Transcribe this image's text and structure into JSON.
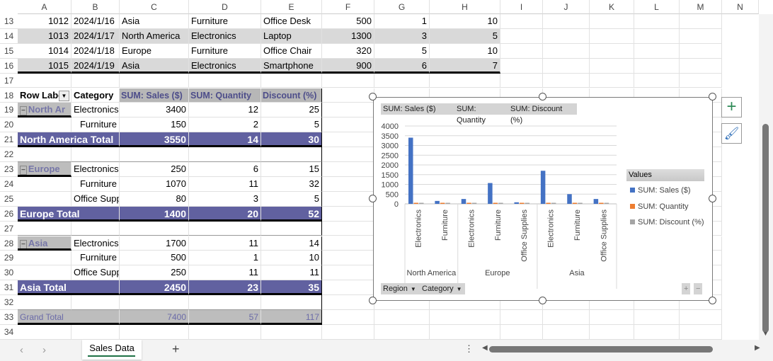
{
  "columns": [
    "A",
    "B",
    "C",
    "D",
    "E",
    "F",
    "G",
    "H",
    "I",
    "J",
    "K",
    "L",
    "M",
    "N"
  ],
  "rows": [
    {
      "n": "13",
      "type": "data",
      "cells": [
        "1012",
        "2024/1/16",
        "Asia",
        "Furniture",
        "Office Desk",
        "500",
        "1",
        "10"
      ]
    },
    {
      "n": "14",
      "type": "alt",
      "cells": [
        "1013",
        "2024/1/17",
        "North America",
        "Electronics",
        "Laptop",
        "1300",
        "3",
        "5"
      ]
    },
    {
      "n": "15",
      "type": "data",
      "cells": [
        "1014",
        "2024/1/18",
        "Europe",
        "Furniture",
        "Office Chair",
        "320",
        "5",
        "10"
      ]
    },
    {
      "n": "16",
      "type": "alt",
      "cells": [
        "1015",
        "2024/1/19",
        "Asia",
        "Electronics",
        "Smartphone",
        "900",
        "6",
        "7"
      ]
    },
    {
      "n": "17",
      "type": "blank",
      "cells": []
    },
    {
      "n": "18",
      "type": "phead",
      "cells": [
        "Row Labe",
        "Category",
        "SUM: Sales ($)",
        "SUM: Quantity",
        "Discount (%)"
      ]
    },
    {
      "n": "19",
      "type": "item",
      "cells": [
        "North Ar",
        "Electronics",
        "3400",
        "12",
        "25"
      ]
    },
    {
      "n": "20",
      "type": "item",
      "cells": [
        "",
        "Furniture",
        "150",
        "2",
        "5"
      ]
    },
    {
      "n": "21",
      "type": "total",
      "cells": [
        "North America Total",
        "",
        "3550",
        "14",
        "30"
      ]
    },
    {
      "n": "22",
      "type": "pblank",
      "cells": []
    },
    {
      "n": "23",
      "type": "item",
      "cells": [
        "Europe",
        "Electronics",
        "250",
        "6",
        "15"
      ]
    },
    {
      "n": "24",
      "type": "item",
      "cells": [
        "",
        "Furniture",
        "1070",
        "11",
        "32"
      ]
    },
    {
      "n": "25",
      "type": "item",
      "cells": [
        "",
        "Office Supplies",
        "80",
        "3",
        "5"
      ]
    },
    {
      "n": "26",
      "type": "total",
      "cells": [
        "Europe Total",
        "",
        "1400",
        "20",
        "52"
      ]
    },
    {
      "n": "27",
      "type": "pblank",
      "cells": []
    },
    {
      "n": "28",
      "type": "item",
      "cells": [
        "Asia",
        "Electronics",
        "1700",
        "11",
        "14"
      ]
    },
    {
      "n": "29",
      "type": "item",
      "cells": [
        "",
        "Furniture",
        "500",
        "1",
        "10"
      ]
    },
    {
      "n": "30",
      "type": "item",
      "cells": [
        "",
        "Office Supplies",
        "250",
        "11",
        "11"
      ]
    },
    {
      "n": "31",
      "type": "total",
      "cells": [
        "Asia Total",
        "",
        "2450",
        "23",
        "35"
      ]
    },
    {
      "n": "32",
      "type": "pblank",
      "cells": []
    },
    {
      "n": "33",
      "type": "grand",
      "cells": [
        "Grand Total",
        "",
        "7400",
        "57",
        "117"
      ]
    },
    {
      "n": "34",
      "type": "blank",
      "cells": []
    }
  ],
  "chart_data": {
    "type": "bar",
    "field_buttons": [
      "SUM: Sales ($)",
      "SUM: Quantity",
      "SUM: Discount (%)"
    ],
    "axis_buttons": [
      "Region",
      "Category"
    ],
    "groups": [
      {
        "name": "North America",
        "categories": [
          "Electronics",
          "Furniture"
        ]
      },
      {
        "name": "Europe",
        "categories": [
          "Electronics",
          "Furniture",
          "Office Supplies"
        ]
      },
      {
        "name": "Asia",
        "categories": [
          "Electronics",
          "Furniture",
          "Office Supplies"
        ]
      }
    ],
    "series": [
      {
        "name": "SUM: Sales ($)",
        "color": "#4472c4",
        "values": [
          3400,
          150,
          250,
          1070,
          80,
          1700,
          500,
          250
        ]
      },
      {
        "name": "SUM: Quantity",
        "color": "#ed7d31",
        "values": [
          12,
          2,
          6,
          11,
          3,
          11,
          1,
          11
        ]
      },
      {
        "name": "SUM: Discount (%)",
        "color": "#a5a5a5",
        "values": [
          25,
          5,
          15,
          32,
          5,
          14,
          10,
          11
        ]
      }
    ],
    "yticks": [
      "0",
      "500",
      "1000",
      "1500",
      "2000",
      "2500",
      "3000",
      "3500",
      "4000"
    ],
    "ylim": [
      0,
      4000
    ],
    "legend_title": "Values",
    "legend": "right"
  },
  "sheet_tab": "Sales Data",
  "add_sheet": "+"
}
